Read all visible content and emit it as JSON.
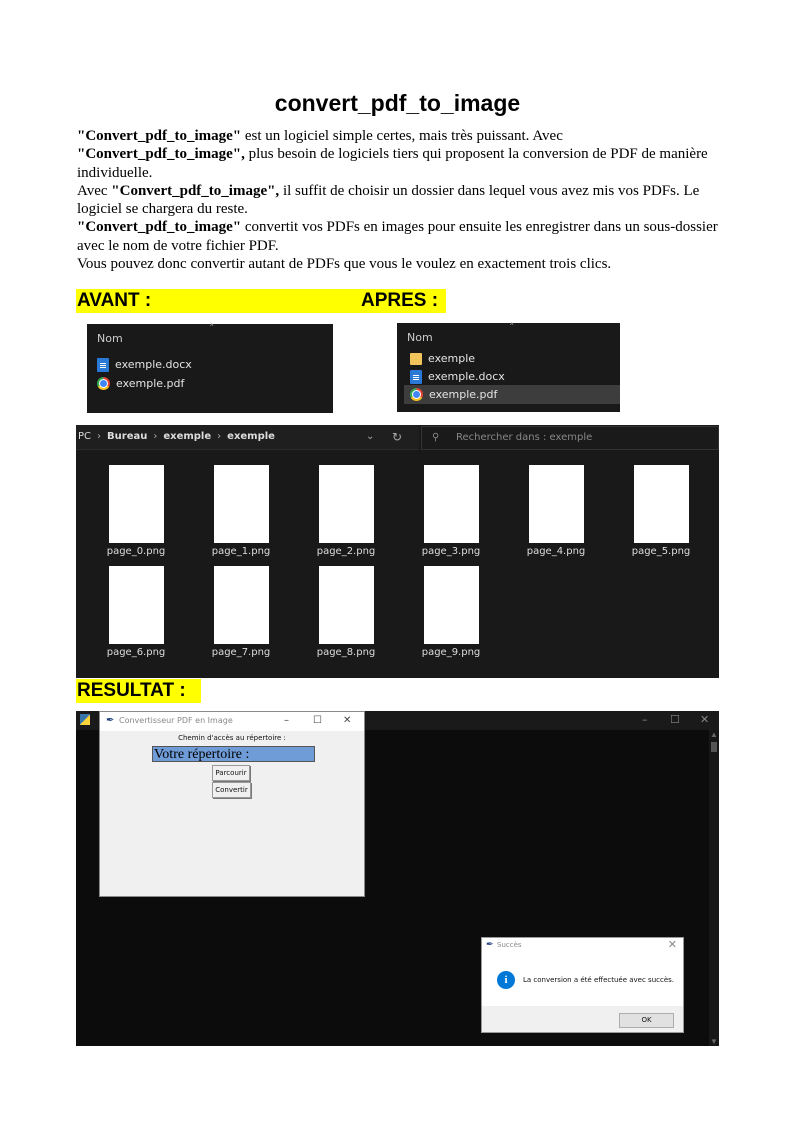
{
  "title": "convert_pdf_to_image",
  "intro": {
    "p1_bold": "\"Convert_pdf_to_image\"",
    "p1_rest": " est un logiciel simple certes, mais très puissant. Avec",
    "p2_bold": "\"Convert_pdf_to_image\",",
    "p2_rest": "  plus besoin de logiciels tiers qui proposent la conversion de PDF de manière individuelle.",
    "p3_start": "Avec ",
    "p3_bold": "\"Convert_pdf_to_image\",",
    "p3_rest": " il suffit de choisir un dossier dans lequel vous avez mis vos PDFs. Le logiciel se chargera du reste.",
    "p4_bold": "\"Convert_pdf_to_image\"",
    "p4_rest": " convertit vos PDFs en images pour ensuite les enregistrer dans un sous-dossier avec le nom de votre fichier PDF.",
    "p5": "Vous pouvez donc convertir autant de PDFs que vous le voulez en exactement trois clics."
  },
  "labels": {
    "avant": "AVANT :",
    "apres": "APRES :",
    "resultat": "RESULTAT :"
  },
  "before_explorer": {
    "column": "Nom",
    "files": [
      {
        "name": "exemple.docx",
        "icon": "word-doc-icon"
      },
      {
        "name": "exemple.pdf",
        "icon": "chrome-pdf-icon"
      }
    ]
  },
  "after_explorer": {
    "column": "Nom",
    "files": [
      {
        "name": "exemple",
        "icon": "folder-icon"
      },
      {
        "name": "exemple.docx",
        "icon": "word-doc-icon"
      },
      {
        "name": "exemple.pdf",
        "icon": "chrome-pdf-icon"
      }
    ],
    "selected_index": 2
  },
  "folder_view": {
    "breadcrumb": [
      "PC",
      "Bureau",
      "exemple",
      "exemple"
    ],
    "search_placeholder": "Rechercher dans : exemple",
    "files": [
      "page_0.png",
      "page_1.png",
      "page_2.png",
      "page_3.png",
      "page_4.png",
      "page_5.png",
      "page_6.png",
      "page_7.png",
      "page_8.png",
      "page_9.png"
    ]
  },
  "app_window": {
    "title": "Convertisseur PDF en Image",
    "path_label": "Chemin d'accès au répertoire :",
    "input_value": "Votre répertoire :",
    "browse_button": "Parcourir",
    "convert_button": "Convertir"
  },
  "success_dialog": {
    "title": "Succès",
    "message": "La conversion a été effectuée avec succès.",
    "ok_button": "OK"
  },
  "colors": {
    "highlight": "#ffff00",
    "explorer_bg": "#191919",
    "input_selection": "#6f9bd6",
    "info_icon": "#0078d7"
  }
}
